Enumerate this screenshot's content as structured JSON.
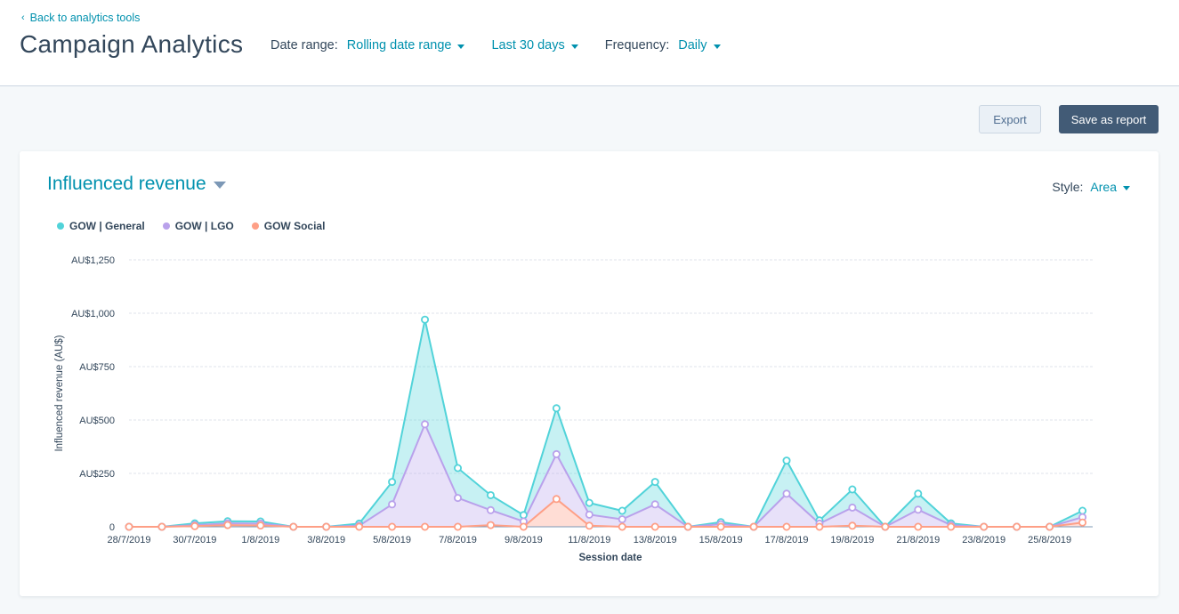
{
  "header": {
    "back_link": "Back to analytics tools",
    "title": "Campaign Analytics",
    "filters": {
      "date_range_label": "Date range:",
      "date_range_value": "Rolling date range",
      "period_value": "Last 30 days",
      "frequency_label": "Frequency:",
      "frequency_value": "Daily"
    }
  },
  "toolbar": {
    "export_label": "Export",
    "save_label": "Save as report"
  },
  "card": {
    "metric_label": "Influenced revenue",
    "style_label": "Style:",
    "style_value": "Area"
  },
  "colors": {
    "general": "#51d3d9",
    "lgo": "#b9a1eb",
    "social": "#fe9f86",
    "accent": "#0091ae"
  },
  "chart_data": {
    "type": "area",
    "stacked": true,
    "title": "Influenced revenue",
    "xlabel": "Session date",
    "ylabel": "Influenced revenue (AU$)",
    "ylim": [
      0,
      1250
    ],
    "yticks": [
      0,
      250,
      500,
      750,
      1000,
      1250
    ],
    "ytick_labels": [
      "0",
      "AU$250",
      "AU$500",
      "AU$750",
      "AU$1,000",
      "AU$1,250"
    ],
    "grid": true,
    "legend_position": "top-left",
    "x": [
      "28/7/2019",
      "29/7/2019",
      "30/7/2019",
      "31/7/2019",
      "1/8/2019",
      "2/8/2019",
      "3/8/2019",
      "4/8/2019",
      "5/8/2019",
      "6/8/2019",
      "7/8/2019",
      "8/8/2019",
      "9/8/2019",
      "10/8/2019",
      "11/8/2019",
      "12/8/2019",
      "13/8/2019",
      "14/8/2019",
      "15/8/2019",
      "16/8/2019",
      "17/8/2019",
      "18/8/2019",
      "19/8/2019",
      "20/8/2019",
      "21/8/2019",
      "22/8/2019",
      "23/8/2019",
      "24/8/2019",
      "25/8/2019",
      "26/8/2019"
    ],
    "xtick_labels": [
      "28/7/2019",
      "30/7/2019",
      "1/8/2019",
      "3/8/2019",
      "5/8/2019",
      "7/8/2019",
      "9/8/2019",
      "11/8/2019",
      "13/8/2019",
      "15/8/2019",
      "17/8/2019",
      "19/8/2019",
      "21/8/2019",
      "23/8/2019",
      "25/8/2019"
    ],
    "series": [
      {
        "name": "GOW Social",
        "color": "#fe9f86",
        "values": [
          0,
          0,
          3,
          8,
          6,
          0,
          0,
          0,
          0,
          0,
          0,
          8,
          0,
          130,
          5,
          0,
          0,
          0,
          0,
          0,
          0,
          0,
          5,
          0,
          0,
          0,
          0,
          0,
          0,
          20
        ]
      },
      {
        "name": "GOW | LGO",
        "color": "#b9a1eb",
        "values": [
          0,
          0,
          5,
          8,
          9,
          0,
          0,
          5,
          105,
          480,
          135,
          70,
          25,
          210,
          52,
          35,
          105,
          0,
          12,
          0,
          155,
          15,
          85,
          0,
          80,
          8,
          0,
          0,
          0,
          25
        ]
      },
      {
        "name": "GOW | General",
        "color": "#51d3d9",
        "values": [
          0,
          0,
          8,
          10,
          10,
          0,
          0,
          10,
          105,
          490,
          140,
          70,
          30,
          215,
          55,
          40,
          105,
          0,
          10,
          0,
          155,
          15,
          85,
          0,
          75,
          8,
          0,
          0,
          0,
          30
        ]
      }
    ]
  }
}
